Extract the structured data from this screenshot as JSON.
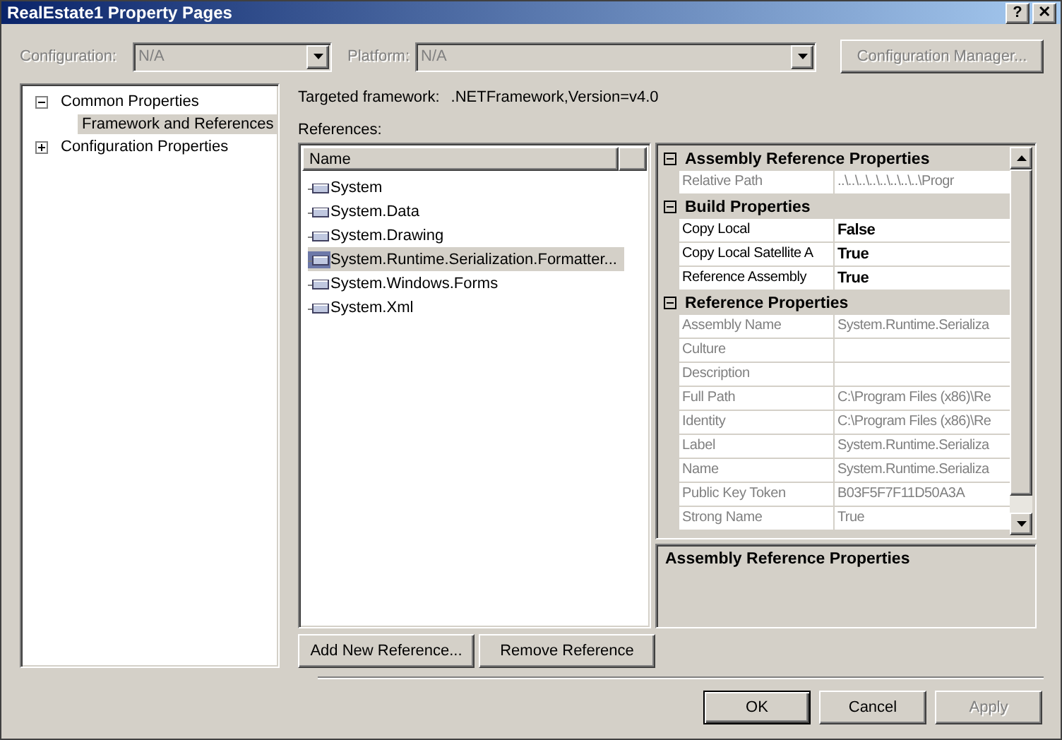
{
  "window": {
    "title": "RealEstate1 Property Pages"
  },
  "title_buttons": [
    {
      "label": "?"
    },
    {
      "label": "✕"
    }
  ],
  "toolbar": {
    "configuration": {
      "label": "Configuration:",
      "value": "N/A",
      "disabled": true
    },
    "platform": {
      "label": "Platform:",
      "value": "N/A",
      "disabled": true
    },
    "manager_button": {
      "label": "Configuration Manager...",
      "disabled": true
    }
  },
  "tree": [
    {
      "label": "Common Properties",
      "expanded": true,
      "selected": false,
      "children": [
        {
          "label": "Framework and References",
          "selected": true
        }
      ]
    },
    {
      "label": "Configuration Properties",
      "expanded": false,
      "selected": false
    }
  ],
  "targeted_framework": {
    "label": "Targeted framework:",
    "value": ".NETFramework,Version=v4.0"
  },
  "references": {
    "label": "References:",
    "column": "Name",
    "items": [
      {
        "name": "System",
        "selected": false
      },
      {
        "name": "System.Data",
        "selected": false
      },
      {
        "name": "System.Drawing",
        "selected": false
      },
      {
        "name": "System.Runtime.Serialization.Formatter...",
        "selected": true
      },
      {
        "name": "System.Windows.Forms",
        "selected": false
      },
      {
        "name": "System.Xml",
        "selected": false
      }
    ]
  },
  "properties": [
    {
      "kind": "category",
      "label": "Assembly Reference Properties",
      "expanded": true
    },
    {
      "kind": "property",
      "label": "Relative Path",
      "value": "..\\..\\..\\..\\..\\..\\..\\..\\Progr",
      "readonly": true,
      "bold": false
    },
    {
      "kind": "category",
      "label": "Build Properties",
      "expanded": true
    },
    {
      "kind": "property",
      "label": "Copy Local",
      "value": "False",
      "readonly": false,
      "bold": true
    },
    {
      "kind": "property",
      "label": "Copy Local Satellite A",
      "value": "True",
      "readonly": false,
      "bold": true
    },
    {
      "kind": "property",
      "label": "Reference Assembly",
      "value": "True",
      "readonly": false,
      "bold": true
    },
    {
      "kind": "category",
      "label": "Reference Properties",
      "expanded": true
    },
    {
      "kind": "property",
      "label": "Assembly Name",
      "value": "System.Runtime.Serializa",
      "readonly": true,
      "bold": false
    },
    {
      "kind": "property",
      "label": "Culture",
      "readonly": true,
      "bold": false
    },
    {
      "kind": "property",
      "label": "Description",
      "readonly": true,
      "bold": false
    },
    {
      "kind": "property",
      "label": "Full Path",
      "value": "C:\\Program Files (x86)\\Re",
      "readonly": true,
      "bold": false
    },
    {
      "kind": "property",
      "label": "Identity",
      "value": "C:\\Program Files (x86)\\Re",
      "readonly": true,
      "bold": false
    },
    {
      "kind": "property",
      "label": "Label",
      "value": "System.Runtime.Serializa",
      "readonly": true,
      "bold": false
    },
    {
      "kind": "property",
      "label": "Name",
      "value": "System.Runtime.Serializa",
      "readonly": true,
      "bold": false
    },
    {
      "kind": "property",
      "label": "Public Key Token",
      "value": "B03F5F7F11D50A3A",
      "readonly": true,
      "bold": false
    },
    {
      "kind": "property",
      "label": "Strong Name",
      "value": "True",
      "readonly": true,
      "bold": false
    }
  ],
  "description": {
    "title": "Assembly Reference Properties"
  },
  "reference_buttons": [
    {
      "label": "Add New Reference...",
      "disabled": false
    },
    {
      "label": "Remove Reference",
      "disabled": false
    }
  ],
  "dialog_buttons": [
    {
      "label": "OK",
      "default": true,
      "disabled": false
    },
    {
      "label": "Cancel",
      "default": false,
      "disabled": false
    },
    {
      "label": "Apply",
      "default": false,
      "disabled": true
    }
  ]
}
